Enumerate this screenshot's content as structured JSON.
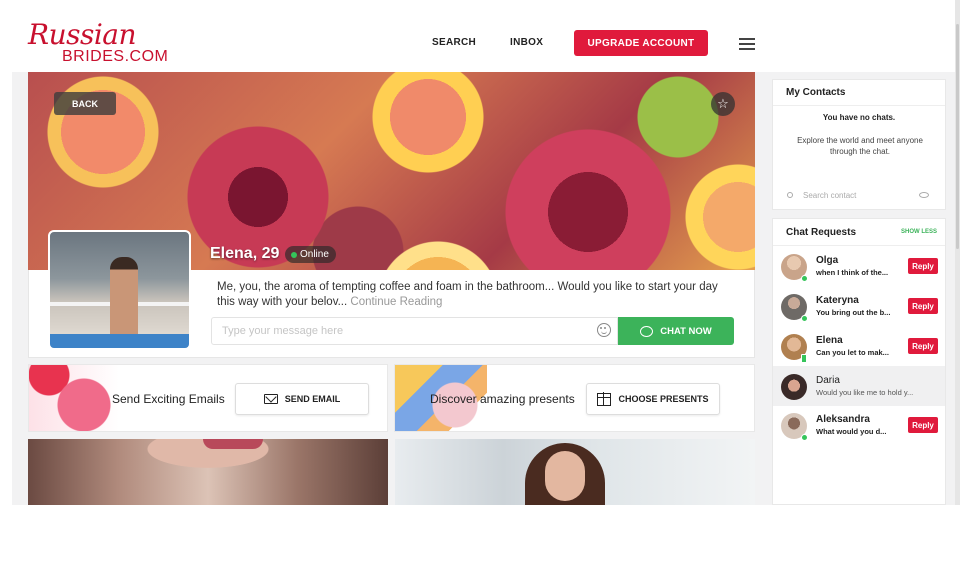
{
  "header": {
    "logo_script": "Russian",
    "logo_brides": "BRIDES.COM",
    "nav_search": "SEARCH",
    "nav_inbox": "INBOX",
    "upgrade": "UPGRADE ACCOUNT",
    "menu_icon": "hamburger-menu-icon"
  },
  "hero": {
    "back": "BACK",
    "favorite_icon": "star-icon"
  },
  "profile": {
    "name": "Elena, 29",
    "status": "Online",
    "bio": "Me, you, the aroma of tempting coffee and foam in the bathroom... Would you like to start your day this way with your belov...",
    "continue": "Continue Reading",
    "message_placeholder": "Type your message here",
    "chat_now": "CHAT NOW"
  },
  "features": {
    "email_text": "Send Exciting Emails",
    "email_button": "SEND EMAIL",
    "gift_text": "Discover amazing presents",
    "gift_button": "CHOOSE PRESENTS"
  },
  "sidebar": {
    "contacts_title": "My Contacts",
    "no_chats": "You have no chats.",
    "explore": "Explore the world and meet anyone through the chat.",
    "search_placeholder": "Search contact",
    "requests_title": "Chat Requests",
    "show_less": "SHOW LESS",
    "requests": [
      {
        "name": "Olga",
        "message": "when I think of the...",
        "reply": "Reply",
        "avatar_color": "#c9a48a"
      },
      {
        "name": "Kateryna",
        "message": "You bring out the b...",
        "reply": "Reply",
        "avatar_color": "#6e6a66"
      },
      {
        "name": "Elena",
        "message": "Can you let to mak...",
        "reply": "Reply",
        "avatar_color": "#b08050"
      },
      {
        "name": "Daria",
        "message": "Would you like me to hold y...",
        "reply": "",
        "avatar_color": "#3a2a28"
      },
      {
        "name": "Aleksandra",
        "message": "What would you d...",
        "reply": "Reply",
        "avatar_color": "#d8c8bc"
      }
    ]
  },
  "colors": {
    "brand_red": "#e01a3c",
    "online_green": "#35c45a",
    "chat_green": "#3cb35a"
  }
}
